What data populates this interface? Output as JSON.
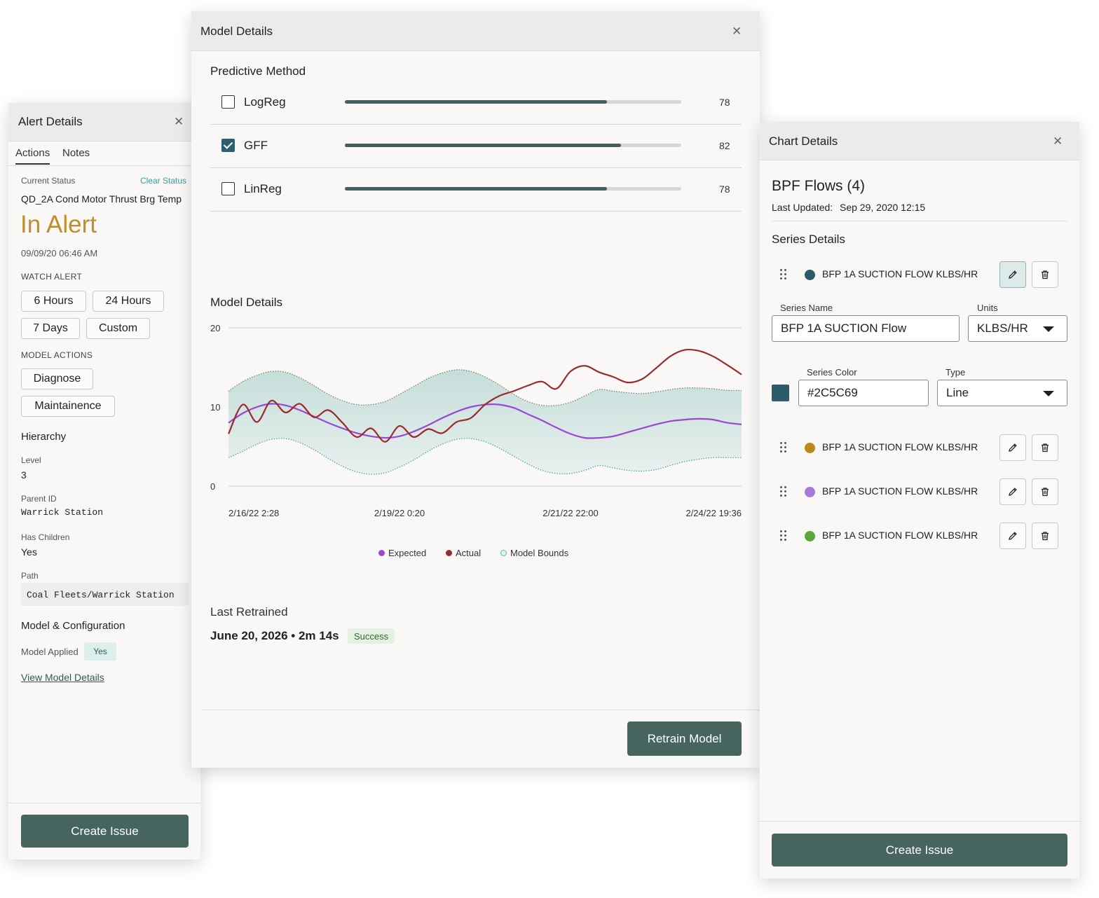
{
  "alert_panel": {
    "title": "Alert Details",
    "tabs": [
      "Actions",
      "Notes"
    ],
    "current_status_label": "Current Status",
    "clear_status": "Clear Status",
    "tag_name": "QD_2A Cond Motor Thrust Brg Temp",
    "status": "In Alert",
    "timestamp": "09/09/20 06:46 AM",
    "watch_alert_heading": "WATCH ALERT",
    "watch_buttons": [
      "6 Hours",
      "24 Hours",
      "7 Days",
      "Custom"
    ],
    "model_actions_heading": "MODEL ACTIONS",
    "model_action_buttons": [
      "Diagnose",
      "Maintainence"
    ],
    "hierarchy_heading": "Hierarchy",
    "level_label": "Level",
    "level_value": "3",
    "parent_id_label": "Parent ID",
    "parent_id_value": "Warrick Station",
    "has_children_label": "Has Children",
    "has_children_value": "Yes",
    "path_label": "Path",
    "path_value": "Coal Fleets/Warrick Station",
    "model_config_heading": "Model & Configuration",
    "model_applied_label": "Model Applied",
    "model_applied_value": "Yes",
    "view_model_details": "View Model Details",
    "create_issue": "Create Issue"
  },
  "model_panel": {
    "title": "Model Details",
    "predictive_method_heading": "Predictive Method",
    "methods": [
      {
        "name": "LogReg",
        "score": 78,
        "checked": false
      },
      {
        "name": "GFF",
        "score": 82,
        "checked": true
      },
      {
        "name": "LinReg",
        "score": 78,
        "checked": false
      }
    ],
    "chart_heading": "Model Details",
    "last_retrained_label": "Last Retrained",
    "last_retrained_value": "June 20, 2026 • 2m 14s",
    "retrain_status": "Success",
    "retrain_button": "Retrain Model"
  },
  "chart_data": {
    "type": "line",
    "title": "",
    "xlabel": "",
    "ylabel": "",
    "ylim": [
      0,
      20
    ],
    "yticks": [
      0,
      10,
      20
    ],
    "xtick_labels": [
      "2/16/22 2:28",
      "2/19/22 0:20",
      "2/21/22 22:00",
      "2/24/22 19:36"
    ],
    "grid": true,
    "legend_position": "bottom",
    "x": [
      0,
      0.5,
      1,
      1.5,
      2,
      2.5,
      3,
      3.5,
      4,
      4.5,
      5,
      5.5,
      6,
      6.5,
      7,
      7.5,
      8,
      8.5,
      9,
      9.5,
      10,
      10.5,
      11,
      11.5,
      12,
      12.5,
      13,
      13.5,
      14,
      14.5,
      15,
      15.5,
      16,
      16.5,
      17,
      17.5,
      18
    ],
    "series": [
      {
        "name": "Expected",
        "color": "#9a46d6",
        "values": [
          8.0,
          9.2,
          10.0,
          10.4,
          10.2,
          9.6,
          8.8,
          8.0,
          7.3,
          6.7,
          6.3,
          6.1,
          6.3,
          6.9,
          7.7,
          8.6,
          9.4,
          10.0,
          10.3,
          10.3,
          9.9,
          9.1,
          8.3,
          7.4,
          6.6,
          6.1,
          6.1,
          6.3,
          6.8,
          7.3,
          7.8,
          8.2,
          8.4,
          8.5,
          8.4,
          8.0,
          7.8
        ]
      },
      {
        "name": "Actual",
        "color": "#9b2b2b",
        "values": [
          6.6,
          10.3,
          8.1,
          10.8,
          9.3,
          10.4,
          8.7,
          9.6,
          8.0,
          6.2,
          7.3,
          5.6,
          7.6,
          6.2,
          7.2,
          6.7,
          8.1,
          8.6,
          10.3,
          11.4,
          12.0,
          12.7,
          13.2,
          12.3,
          14.5,
          15.2,
          14.4,
          13.8,
          13.1,
          13.5,
          14.9,
          16.4,
          17.2,
          17.1,
          16.4,
          15.3,
          14.1
        ]
      },
      {
        "name": "Model Bounds",
        "color": "#5bb8b0",
        "upper": [
          12.0,
          13.2,
          14.0,
          14.5,
          14.4,
          13.7,
          12.7,
          11.6,
          10.8,
          10.3,
          10.3,
          10.7,
          11.6,
          12.6,
          13.6,
          14.3,
          14.7,
          14.5,
          13.8,
          12.8,
          11.6,
          10.7,
          10.2,
          10.2,
          10.6,
          11.4,
          12.2,
          12.0,
          11.8,
          11.7,
          11.9,
          12.2,
          12.4,
          12.4,
          12.3,
          12.1,
          12.1
        ],
        "lower": [
          3.6,
          4.4,
          5.3,
          5.9,
          6.0,
          5.5,
          4.6,
          3.5,
          2.5,
          1.8,
          1.5,
          1.7,
          2.4,
          3.3,
          4.4,
          5.3,
          5.9,
          6.0,
          5.6,
          4.8,
          3.8,
          2.8,
          2.0,
          1.6,
          1.6,
          2.0,
          2.6,
          2.3,
          2.0,
          1.9,
          2.1,
          2.6,
          3.1,
          3.4,
          3.6,
          3.6,
          3.6
        ]
      }
    ]
  },
  "chart_panel": {
    "title": "Chart Details",
    "chart_name": "BPF Flows (4)",
    "last_updated_label": "Last Updated:",
    "last_updated_value": "Sep 29, 2020 12:15",
    "series_details_heading": "Series Details",
    "series": [
      {
        "name": "BFP 1A SUCTION FLOW KLBS/HR",
        "color": "#2c5c69"
      },
      {
        "name": "BFP 1A SUCTION FLOW KLBS/HR",
        "color": "#b8891f"
      },
      {
        "name": "BFP 1A SUCTION FLOW KLBS/HR",
        "color": "#a87ad8"
      },
      {
        "name": "BFP 1A SUCTION FLOW KLBS/HR",
        "color": "#5aa83a"
      }
    ],
    "series_name_label": "Series Name",
    "series_name_value": "BFP 1A SUCTION Flow",
    "units_label": "Units",
    "units_value": "KLBS/HR",
    "series_color_label": "Series Color",
    "series_color_value": "#2C5C69",
    "type_label": "Type",
    "type_value": "Line",
    "create_issue": "Create Issue"
  },
  "colors": {
    "primary_button": "#46655f",
    "alert_status": "#c08f2a",
    "accent_link": "#3a9c95"
  },
  "icons": [
    "close-icon",
    "check-icon",
    "drag-handle-icon",
    "pencil-icon",
    "trash-icon",
    "chevron-down-icon"
  ]
}
